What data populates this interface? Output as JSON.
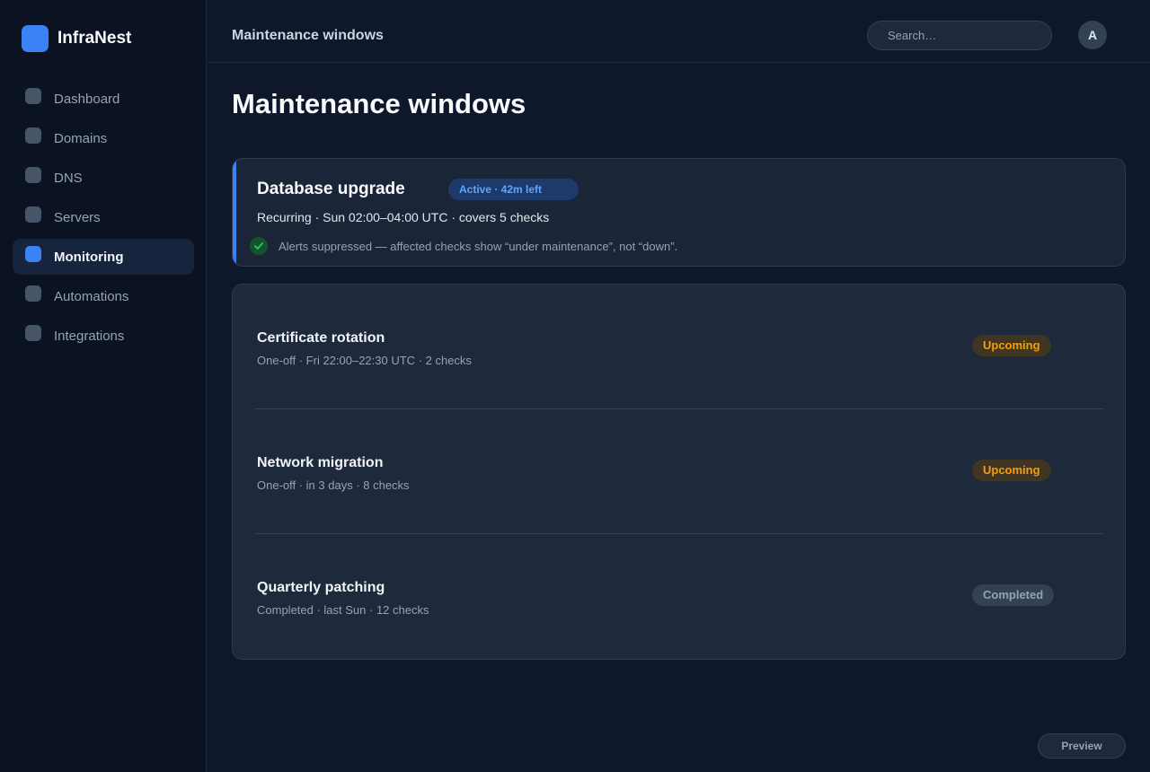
{
  "brand": {
    "name": "InfraNest"
  },
  "sidebar": {
    "items": [
      {
        "label": "Dashboard"
      },
      {
        "label": "Domains"
      },
      {
        "label": "DNS"
      },
      {
        "label": "Servers"
      },
      {
        "label": "Monitoring",
        "active": true
      },
      {
        "label": "Automations"
      },
      {
        "label": "Integrations"
      }
    ]
  },
  "topbar": {
    "title": "Maintenance windows",
    "search_placeholder": "Search…",
    "avatar_initial": "A"
  },
  "page": {
    "title": "Maintenance windows"
  },
  "active_window": {
    "name": "Database upgrade",
    "badge": "Active · 42m left",
    "schedule": "Recurring · Sun 02:00–04:00 UTC · covers 5 checks",
    "note": "Alerts suppressed — affected checks show “under maintenance”, not “down”."
  },
  "windows": [
    {
      "name": "Certificate rotation",
      "meta": "One-off · Fri 22:00–22:30 UTC · 2 checks",
      "status": "Upcoming"
    },
    {
      "name": "Network migration",
      "meta": "One-off · in 3 days · 8 checks",
      "status": "Upcoming"
    },
    {
      "name": "Quarterly patching",
      "meta": "Completed · last Sun · 12 checks",
      "status": "Completed"
    }
  ],
  "footer": {
    "preview_label": "Preview"
  },
  "colors": {
    "accent": "#3b82f6",
    "upcoming": "#f59e0b",
    "success": "#22c55e"
  }
}
